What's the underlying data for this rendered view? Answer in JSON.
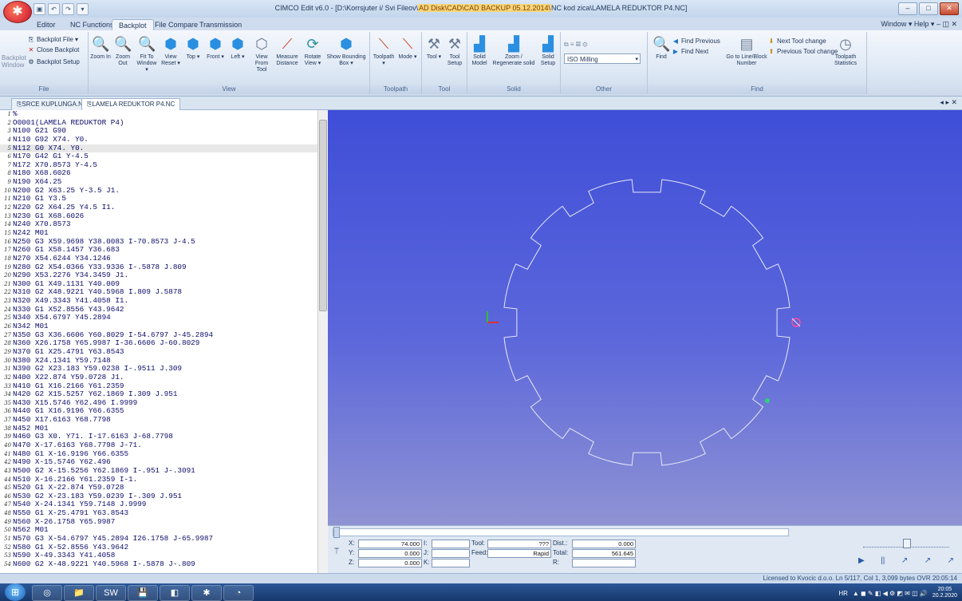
{
  "window": {
    "title_prefix": "CIMCO Edit v6.0 - [D:\\Korrsjuter i/ Svi Fileov\\",
    "title_highlight": "AD Disk\\CAD\\CAD BACKUP 05.12.2014\\",
    "title_suffix": "NC kod zica\\LAMELA REDUKTOR P4.NC]",
    "qat": [
      "▣",
      "↶",
      "↷",
      "▾"
    ],
    "controls": [
      "–",
      "□",
      "✕"
    ]
  },
  "ribbon_tabs": [
    "Editor",
    "NC Functions",
    "Backplot",
    "File Compare",
    "Transmission"
  ],
  "ribbon_active": "Backplot",
  "ribbon_right": "Window ▾  Help ▾  –  ◫  ✕",
  "groups": {
    "file": "File",
    "view": "View",
    "toolpath": "Toolpath",
    "tool": "Tool",
    "solid": "Solid",
    "other": "Other",
    "find": "Find"
  },
  "file_group": {
    "backplot_file": "Backplot File ▾",
    "close_backplot": "Close Backplot",
    "backplot_window": "Backplot\nWindow",
    "backplot_setup": "Backplot Setup"
  },
  "view_buttons": [
    {
      "label": "Zoom In",
      "icon": "🔍",
      "name": "zoom-in-button"
    },
    {
      "label": "Zoom Out",
      "icon": "🔍",
      "name": "zoom-out-button"
    },
    {
      "label": "Fit To Window ▾",
      "icon": "🔍",
      "name": "fit-to-window-button"
    },
    {
      "label": "View Reset ▾",
      "icon": "⬢",
      "name": "view-reset-button"
    },
    {
      "label": "Top ▾",
      "icon": "⬢",
      "name": "view-top-button"
    },
    {
      "label": "Front ▾",
      "icon": "⬢",
      "name": "view-front-button"
    },
    {
      "label": "Left ▾",
      "icon": "⬢",
      "name": "view-left-button"
    },
    {
      "label": "View From Tool",
      "icon": "⬡",
      "name": "view-from-tool-button"
    },
    {
      "label": "Measure Distance",
      "icon": "⟋",
      "name": "measure-distance-button"
    },
    {
      "label": "Rotate View ▾",
      "icon": "⟳",
      "name": "rotate-view-button"
    },
    {
      "label": "Show Bounding Box ▾",
      "icon": "⬢",
      "name": "show-bounding-box-button"
    }
  ],
  "toolpath_buttons": [
    {
      "label": "Toolpath ▾",
      "icon": "⟍",
      "name": "toolpath-button"
    },
    {
      "label": "Mode ▾",
      "icon": "⟍",
      "name": "mode-button"
    }
  ],
  "tool_buttons": [
    {
      "label": "Tool ▾",
      "icon": "⚒",
      "name": "tool-button"
    },
    {
      "label": "Tool Setup",
      "icon": "⚒",
      "name": "tool-setup-button"
    }
  ],
  "solid_buttons": [
    {
      "label": "Solid Model",
      "icon": "▟",
      "name": "solid-model-button"
    },
    {
      "label": "Zoom / Regenerate solid",
      "icon": "▟",
      "name": "zoom-regenerate-solid-button"
    },
    {
      "label": "Solid Setup",
      "icon": "▟",
      "name": "solid-setup-button"
    }
  ],
  "other": {
    "mode_select": "ISO Milling",
    "icons": [
      "⧉",
      "≡",
      "▦",
      "⚙"
    ]
  },
  "find_group": {
    "find": "Find",
    "find_previous": "Find Previous",
    "find_next": "Find Next",
    "goto_line": "Go to Line/Block Number",
    "next_tool_change": "Next Tool change",
    "previous_tool_change": "Previous Tool change",
    "toolpath_statistics": "Toolpath Statistics"
  },
  "doc_tabs": [
    "SRCE KUPLUNGA.NC",
    "LAMELA REDUKTOR P4.NC"
  ],
  "doc_tab_nav": "◂ ▸ ✕",
  "nc_lines": [
    "%",
    "O0001(LAMELA REDUKTOR P4)",
    "N100 G21 G90",
    "N110 G92 X74. Y0.",
    "N112 G0 X74. Y0.",
    "N170 G42 G1 Y-4.5",
    "N172 X70.8573 Y-4.5",
    "N180 X68.6026",
    "N190 X64.25",
    "N200 G2 X63.25 Y-3.5 J1.",
    "N210 G1 Y3.5",
    "N220 G2 X64.25 Y4.5 I1.",
    "N230 G1 X68.6026",
    "N240 X70.8573",
    "N242 M01",
    "N250 G3 X59.9698 Y38.0083 I-70.8573 J-4.5",
    "N260 G1 X58.1457 Y36.683",
    "N270 X54.6244 Y34.1246",
    "N280 G2 X54.0366 Y33.9336 I-.5878 J.809",
    "N290 X53.2276 Y34.3459 J1.",
    "N300 G1 X49.1131 Y40.009",
    "N310 G2 X48.9221 Y40.5968 I.809 J.5878",
    "N320 X49.3343 Y41.4058 I1.",
    "N330 G1 X52.8556 Y43.9642",
    "N340 X54.6797 Y45.2894",
    "N342 M01",
    "N350 G3 X36.6606 Y60.8029 I-54.6797 J-45.2894",
    "N360 X26.1758 Y65.9987 I-36.6606 J-60.8029",
    "N370 G1 X25.4791 Y63.8543",
    "N380 X24.1341 Y59.7148",
    "N390 G2 X23.183 Y59.0238 I-.9511 J.309",
    "N400 X22.874 Y59.0728 J1.",
    "N410 G1 X16.2166 Y61.2359",
    "N420 G2 X15.5257 Y62.1869 I.309 J.951",
    "N430 X15.5746 Y62.496 I.9999",
    "N440 G1 X16.9196 Y66.6355",
    "N450 X17.6163 Y68.7798",
    "N452 M01",
    "N460 G3 X0. Y71. I-17.6163 J-68.7798",
    "N470 X-17.6163 Y68.7798 J-71.",
    "N480 G1 X-16.9196 Y66.6355",
    "N490 X-15.5746 Y62.496",
    "N500 G2 X-15.5256 Y62.1869 I-.951 J-.3091",
    "N510 X-16.2166 Y61.2359 I-1.",
    "N520 G1 X-22.874 Y59.0728",
    "N530 G2 X-23.183 Y59.0239 I-.309 J.951",
    "N540 X-24.1341 Y59.7148 J.9999",
    "N550 G1 X-25.4791 Y63.8543",
    "N560 X-26.1758 Y65.9987",
    "N562 M01",
    "N570 G3 X-54.6797 Y45.2894 I26.1758 J-65.9987",
    "N580 G1 X-52.8556 Y43.9642",
    "N590 X-49.3343 Y41.4058",
    "N600 G2 X-48.9221 Y40.5968 I-.5878 J-.809"
  ],
  "highlighted_line": 5,
  "coords": {
    "x_label": "X:",
    "x": "74.000",
    "y_label": "Y:",
    "y": "0.000",
    "z_label": "Z:",
    "z": "0.000",
    "i_label": "I:",
    "j_label": "J:",
    "k_label": "K:",
    "tool_label": "Tool:",
    "tool": "???",
    "feed_label": "Feed:",
    "feed": "Rapid",
    "dist_label": "Dist.:",
    "dist": "0.000",
    "total_label": "Total:",
    "total": "561.645",
    "r_label": "R:"
  },
  "playback_icons": [
    "▶",
    "||",
    "↗",
    "↗",
    "↗"
  ],
  "status": "Licensed to Kvocic d.o.o.    Ln 5/117, Col 1, 3,099 bytes    OVR  20:05:14",
  "taskbar": {
    "apps": [
      "◎",
      "📁",
      "SW",
      "💾",
      "◧",
      "✱",
      "◔"
    ],
    "tray_lang": "HR",
    "tray_icons": "▲ ◼ ✎ ◧ ◀ ⚙ ◩ ✉ ◫ 🔊",
    "time": "20:05",
    "date": "20.2.2020"
  }
}
